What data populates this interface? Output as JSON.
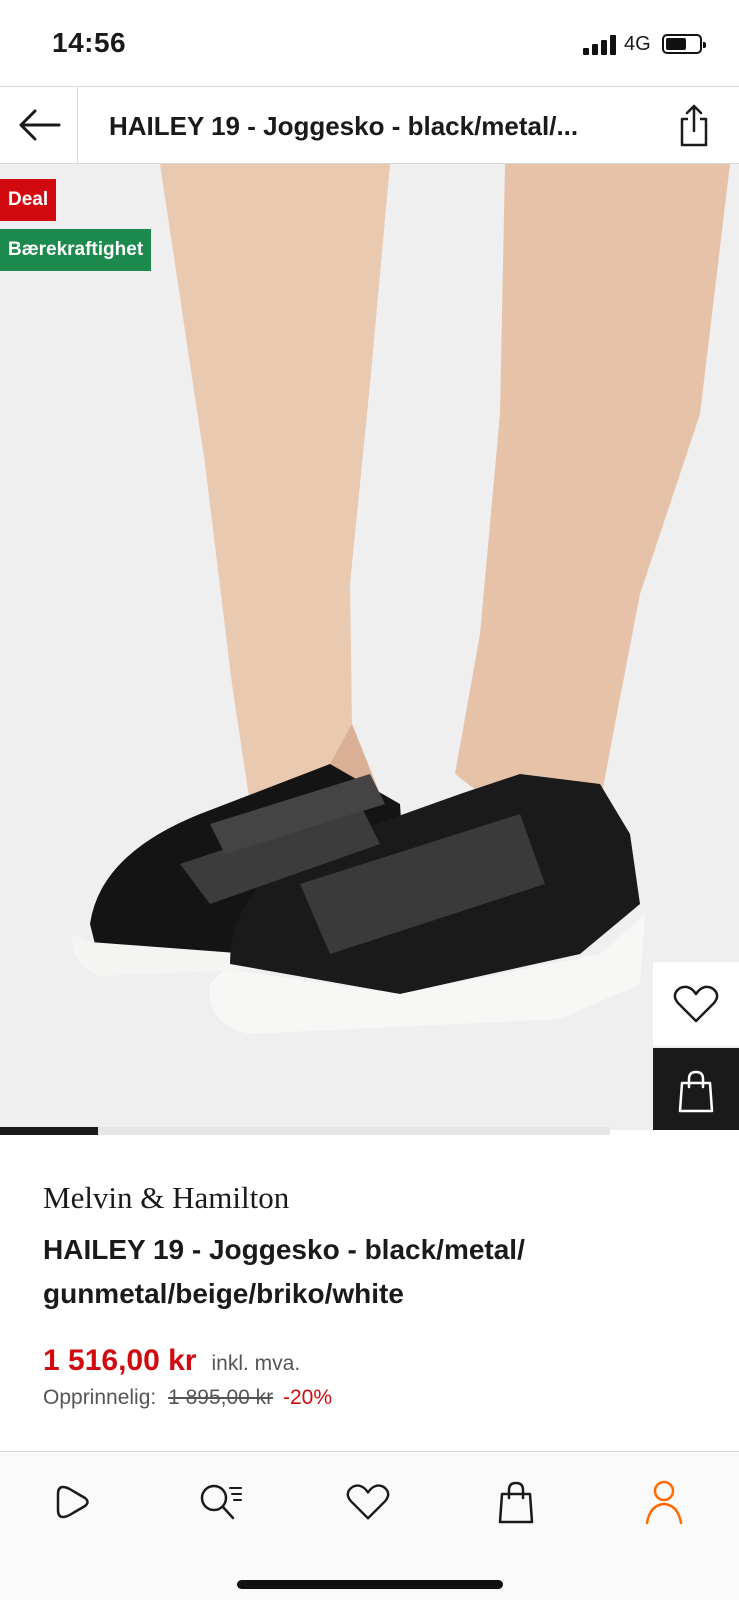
{
  "status_bar": {
    "time": "14:56",
    "network": "4G",
    "signal_bars": 4,
    "battery_level": 0.55
  },
  "header": {
    "title": "HAILEY 19 - Joggesko - black/metal/...",
    "back_icon": "arrow-left-icon",
    "share_icon": "share-icon"
  },
  "hero": {
    "badges": {
      "deal": "Deal",
      "sustainability": "Bærekraftighet"
    },
    "wishlist_icon": "heart-icon",
    "bag_icon": "shopping-bag-icon",
    "gallery_progress": 0.16
  },
  "product": {
    "brand": "Melvin & Hamilton",
    "name": "HAILEY 19 - Joggesko - black/metal/ gunmetal/beige/briko/white",
    "price": "1 516,00 kr",
    "vat_note": "inkl. mva.",
    "original_label": "Opprinnelig:",
    "original_price": "1 895,00 kr",
    "discount": "-20%"
  },
  "bottom_nav": {
    "items": [
      {
        "name": "home",
        "icon": "play-home-icon"
      },
      {
        "name": "search",
        "icon": "search-list-icon"
      },
      {
        "name": "wishlist",
        "icon": "heart-icon"
      },
      {
        "name": "bag",
        "icon": "shopping-bag-icon"
      },
      {
        "name": "account",
        "icon": "user-icon",
        "active": true
      }
    ]
  },
  "colors": {
    "accent_red": "#d20a10",
    "sustain_green": "#1d8a4d",
    "account_orange": "#ff6900",
    "dark": "#1a1a1a"
  }
}
